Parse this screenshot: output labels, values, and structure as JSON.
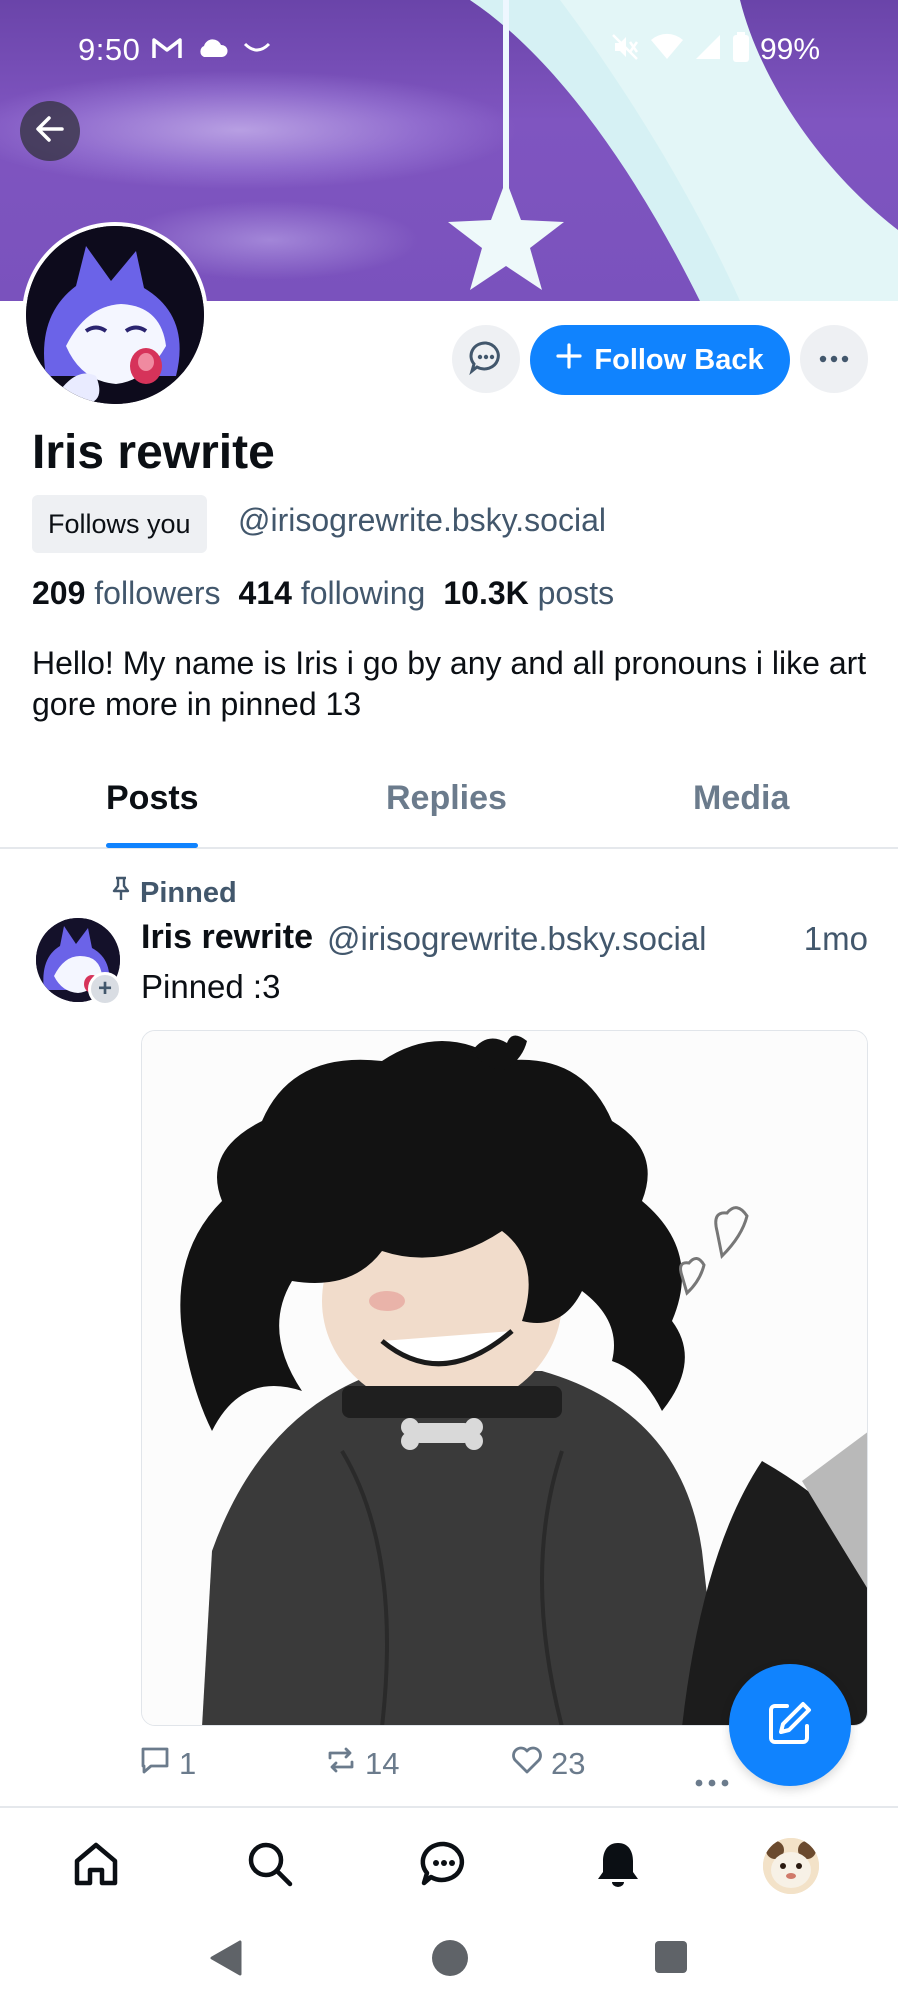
{
  "status_bar": {
    "time": "9:50",
    "battery": "99%",
    "left_icons": [
      "gmail-icon",
      "cloud-icon",
      "smile-icon"
    ],
    "right_icons": [
      "mute-vibrate-icon",
      "wifi-icon",
      "signal-icon",
      "battery-icon"
    ]
  },
  "header": {
    "back_icon": "arrow-left-icon"
  },
  "profile": {
    "display_name": "Iris rewrite",
    "follows_you_label": "Follows you",
    "handle": "@irisogrewrite.bsky.social",
    "stats": {
      "followers_count": "209",
      "followers_label": "followers",
      "following_count": "414",
      "following_label": "following",
      "posts_count": "10.3K",
      "posts_label": "posts"
    },
    "bio": "Hello! My name is Iris i go by any and all pronouns i like art gore more in pinned 13"
  },
  "actions": {
    "follow_label": "Follow Back",
    "message_icon": "chat-bubble-icon",
    "more_icon": "ellipsis-icon"
  },
  "tabs": [
    {
      "label": "Posts",
      "active": true
    },
    {
      "label": "Replies",
      "active": false
    },
    {
      "label": "Media",
      "active": false
    }
  ],
  "post": {
    "pinned_label": "Pinned",
    "author_name": "Iris rewrite",
    "author_handle": "@irisogrewrite.bsky.social",
    "time": "1mo",
    "text": "Pinned :3",
    "replies": "1",
    "reposts": "14",
    "likes": "23"
  },
  "bottom_nav": [
    "home-icon",
    "search-icon",
    "messages-icon",
    "notifications-icon",
    "profile-avatar"
  ],
  "colors": {
    "accent": "#1083fe",
    "banner": "#7a52bd",
    "muted_text": "#42576c"
  }
}
